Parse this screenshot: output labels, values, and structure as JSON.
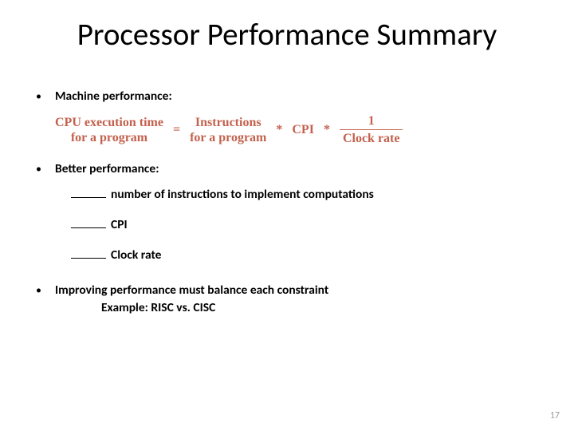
{
  "title": "Processor Performance Summary",
  "bullets": {
    "b1": "Machine performance:",
    "b2": "Better performance:",
    "b3": "Improving performance must balance each constraint",
    "b3sub": "Example: RISC vs. CISC"
  },
  "equation": {
    "lhs_l1": "CPU execution time",
    "lhs_l2": "for a program",
    "eq": "=",
    "t1_l1": "Instructions",
    "t1_l2": "for a program",
    "star": "*",
    "t2": "CPI",
    "frac_num": "1",
    "frac_den": "Clock rate"
  },
  "sub": {
    "s1": "number of instructions to implement computations",
    "s2": "CPI",
    "s3": "Clock rate"
  },
  "pagenum": "17"
}
